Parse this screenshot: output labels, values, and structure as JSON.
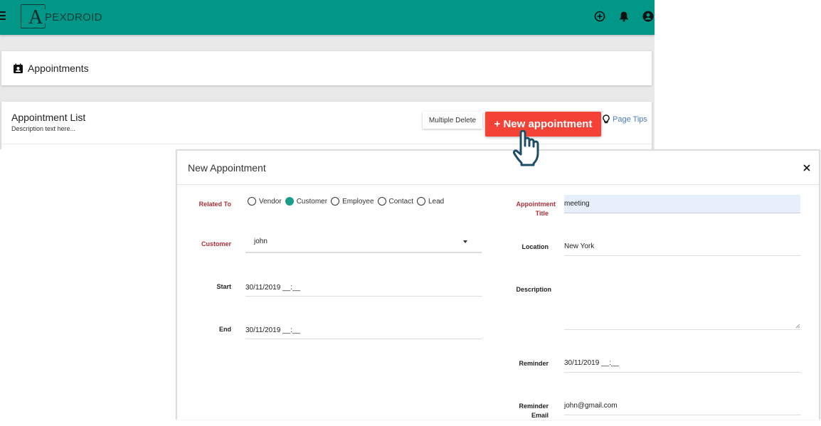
{
  "app": {
    "brand_initial": "A",
    "brand_rest": "PEXDROID",
    "brand_color": "#009688",
    "top_icons": [
      "add-circle-icon",
      "bell-icon",
      "account-circle-icon"
    ]
  },
  "page": {
    "title": "Appointments",
    "title_icon": "contact-calendar-icon"
  },
  "list": {
    "title": "Appointment List",
    "description": "Description text here...",
    "multiple_delete_label": "Multiple Delete",
    "new_appointment_label": "+ New appointment",
    "new_appointment_color": "#f44336",
    "page_tips_label": "Page Tips",
    "page_tips_icon": "lightbulb-icon"
  },
  "cursor": {
    "icon": "hand-pointer-icon"
  },
  "modal": {
    "title": "New Appointment",
    "close_icon": "close-icon",
    "related_to": {
      "label": "Related To",
      "options": [
        "Vendor",
        "Customer",
        "Employee",
        "Contact",
        "Lead"
      ],
      "selected": "Customer",
      "selected_color": "#1a9e8b"
    },
    "customer": {
      "label": "Customer",
      "value": "john"
    },
    "start": {
      "label": "Start",
      "value": "30/11/2019 __:__"
    },
    "end": {
      "label": "End",
      "value": "30/11/2019 __:__"
    },
    "appointment_title": {
      "label_line1": "Appointment",
      "label_line2": "Title",
      "value": "meeting"
    },
    "location": {
      "label": "Location",
      "value": "New York"
    },
    "description": {
      "label": "Description",
      "value": ""
    },
    "reminder": {
      "label": "Reminder",
      "value": "30/11/2019 __:__"
    },
    "reminder_email": {
      "label_line1": "Reminder",
      "label_line2": "Email",
      "value": "john@gmail.com"
    }
  }
}
